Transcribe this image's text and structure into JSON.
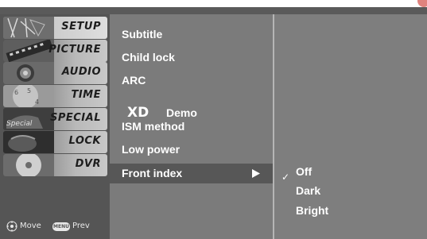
{
  "category_menu": {
    "items": [
      {
        "label": "SETUP",
        "active": true
      },
      {
        "label": "PICTURE"
      },
      {
        "label": "AUDIO"
      },
      {
        "label": "TIME"
      },
      {
        "label": "SPECIAL"
      },
      {
        "label": "LOCK"
      },
      {
        "label": "DVR"
      }
    ],
    "art_text": {
      "special": "Special"
    }
  },
  "hint_bar": {
    "move_label": "Move",
    "menu_key": "MENU",
    "prev_label": "Prev",
    "move_icon": "move-dpad-icon"
  },
  "options": {
    "items": [
      "Subtitle",
      "Child lock",
      "ARC",
      "Demo",
      "ISM method",
      "Low power",
      "Front index"
    ],
    "xd_logo": "XD",
    "selected": "Front index",
    "arrow_icon": "right-triangle-icon"
  },
  "sub_options": {
    "items": [
      "Off",
      "Dark",
      "Bright"
    ],
    "checked": "Off",
    "check_icon": "checkmark-icon"
  },
  "colors": {
    "osd_background": "#7d7d7d",
    "category_background": "#555555",
    "selected_row": "#575757",
    "text": "#ffffff"
  }
}
